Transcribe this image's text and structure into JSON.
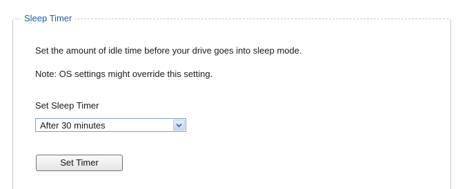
{
  "panel": {
    "title": "Sleep Timer"
  },
  "content": {
    "description": "Set the amount of idle time before your drive goes into sleep mode.",
    "note": "Note: OS settings might override this setting.",
    "timer_label": "Set Sleep Timer"
  },
  "sleep_select": {
    "selected": "After 30 minutes",
    "arrow_icon": "chevron-down-icon"
  },
  "actions": {
    "set_timer_label": "Set Timer"
  },
  "colors": {
    "title": "#1f5fa8",
    "border": "#c8c8c8",
    "select_border": "#7f9db9",
    "arrow": "#4d6185"
  }
}
